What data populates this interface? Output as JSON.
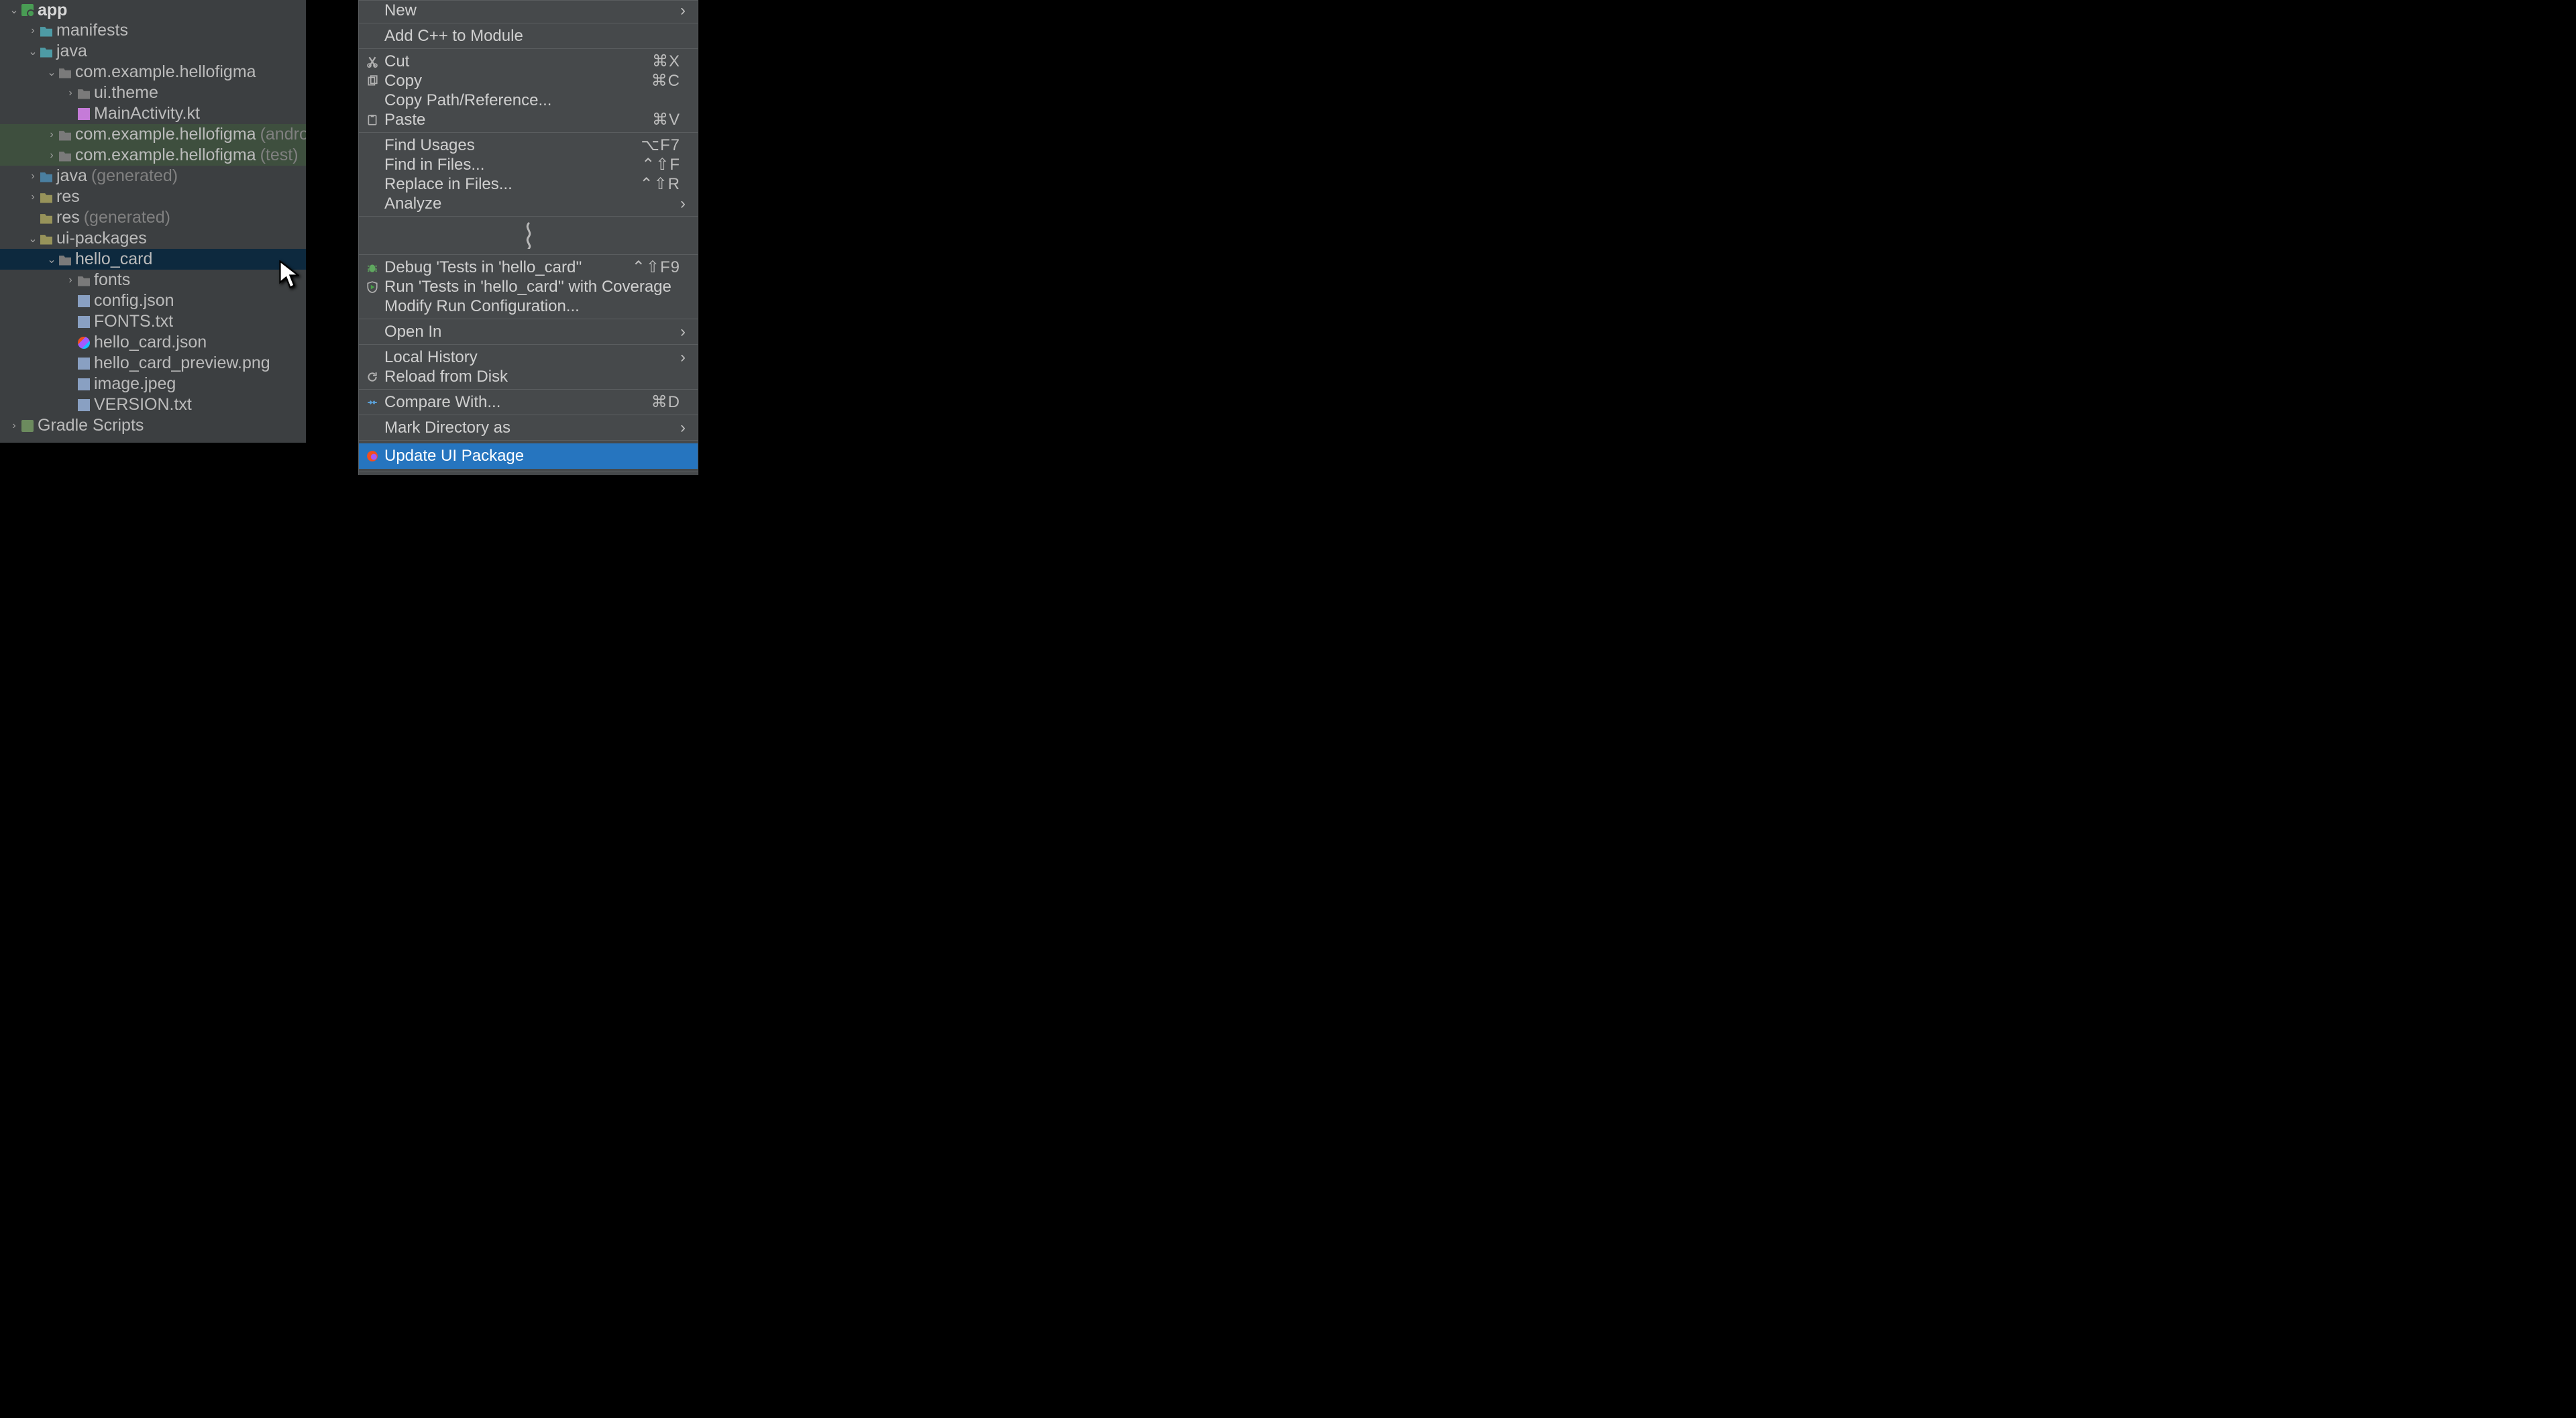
{
  "tree": {
    "rows": [
      {
        "indent": 14,
        "arrow": "v",
        "icon": "module-icon",
        "label": "app",
        "suffix": "",
        "bold": true
      },
      {
        "indent": 42,
        "arrow": ">",
        "icon": "folder-cyan",
        "label": "manifests",
        "suffix": ""
      },
      {
        "indent": 42,
        "arrow": "v",
        "icon": "folder-cyan",
        "label": "java",
        "suffix": ""
      },
      {
        "indent": 70,
        "arrow": "v",
        "icon": "folder-gray",
        "label": "com.example.hellofigma",
        "suffix": ""
      },
      {
        "indent": 98,
        "arrow": ">",
        "icon": "folder-gray",
        "label": "ui.theme",
        "suffix": ""
      },
      {
        "indent": 98,
        "arrow": "",
        "icon": "file-kt",
        "label": "MainActivity.kt",
        "suffix": ""
      },
      {
        "indent": 70,
        "arrow": ">",
        "icon": "folder-gray",
        "label": "com.example.hellofigma",
        "suffix": "(androidTest)",
        "green": true
      },
      {
        "indent": 70,
        "arrow": ">",
        "icon": "folder-gray",
        "label": "com.example.hellofigma",
        "suffix": "(test)",
        "green": true
      },
      {
        "indent": 42,
        "arrow": ">",
        "icon": "folder-gen-o",
        "label": "java",
        "suffix": "(generated)"
      },
      {
        "indent": 42,
        "arrow": ">",
        "icon": "folder-res",
        "label": "res",
        "suffix": ""
      },
      {
        "indent": 42,
        "arrow": "",
        "icon": "folder-res",
        "label": "res",
        "suffix": "(generated)"
      },
      {
        "indent": 42,
        "arrow": "v",
        "icon": "folder-res",
        "label": "ui-packages",
        "suffix": ""
      },
      {
        "indent": 70,
        "arrow": "v",
        "icon": "folder-gray",
        "label": "hello_card",
        "suffix": "",
        "selected": true
      },
      {
        "indent": 98,
        "arrow": ">",
        "icon": "folder-gray",
        "label": "fonts",
        "suffix": ""
      },
      {
        "indent": 98,
        "arrow": "",
        "icon": "file-json",
        "label": "config.json",
        "suffix": ""
      },
      {
        "indent": 98,
        "arrow": "",
        "icon": "file-txt",
        "label": "FONTS.txt",
        "suffix": ""
      },
      {
        "indent": 98,
        "arrow": "",
        "icon": "figma-icon",
        "label": "hello_card.json",
        "suffix": ""
      },
      {
        "indent": 98,
        "arrow": "",
        "icon": "file-png",
        "label": "hello_card_preview.png",
        "suffix": ""
      },
      {
        "indent": 98,
        "arrow": "",
        "icon": "file-png",
        "label": "image.jpeg",
        "suffix": ""
      },
      {
        "indent": 98,
        "arrow": "",
        "icon": "file-txt",
        "label": "VERSION.txt",
        "suffix": ""
      },
      {
        "indent": 14,
        "arrow": ">",
        "icon": "gradle-icon",
        "label": "Gradle Scripts",
        "suffix": ""
      }
    ]
  },
  "menu": {
    "items": [
      {
        "type": "item",
        "icon": "",
        "label": "New",
        "shortcut": "",
        "submenu": true
      },
      {
        "type": "sep"
      },
      {
        "type": "item",
        "icon": "",
        "label": "Add C++ to Module",
        "shortcut": "",
        "submenu": false
      },
      {
        "type": "sep"
      },
      {
        "type": "item",
        "icon": "cut",
        "label": "Cut",
        "shortcut": "⌘X",
        "submenu": false
      },
      {
        "type": "item",
        "icon": "copy",
        "label": "Copy",
        "shortcut": "⌘C",
        "submenu": false
      },
      {
        "type": "item",
        "icon": "",
        "label": "Copy Path/Reference...",
        "shortcut": "",
        "submenu": false
      },
      {
        "type": "item",
        "icon": "paste",
        "label": "Paste",
        "shortcut": "⌘V",
        "submenu": false
      },
      {
        "type": "sep"
      },
      {
        "type": "item",
        "icon": "",
        "label": "Find Usages",
        "shortcut": "⌥F7",
        "submenu": false
      },
      {
        "type": "item",
        "icon": "",
        "label": "Find in Files...",
        "shortcut": "⌃⇧F",
        "submenu": false
      },
      {
        "type": "item",
        "icon": "",
        "label": "Replace in Files...",
        "shortcut": "⌃⇧R",
        "submenu": false
      },
      {
        "type": "item",
        "icon": "",
        "label": "Analyze",
        "shortcut": "",
        "submenu": true
      },
      {
        "type": "sep"
      },
      {
        "type": "squiggle"
      },
      {
        "type": "sep"
      },
      {
        "type": "item",
        "icon": "bug",
        "label": "Debug 'Tests in 'hello_card''",
        "shortcut": "⌃⇧F9",
        "submenu": false
      },
      {
        "type": "item",
        "icon": "coverage",
        "label": "Run 'Tests in 'hello_card'' with Coverage",
        "shortcut": "",
        "submenu": false
      },
      {
        "type": "item",
        "icon": "",
        "label": "Modify Run Configuration...",
        "shortcut": "",
        "submenu": false
      },
      {
        "type": "sep"
      },
      {
        "type": "item",
        "icon": "",
        "label": "Open In",
        "shortcut": "",
        "submenu": true
      },
      {
        "type": "sep"
      },
      {
        "type": "item",
        "icon": "",
        "label": "Local History",
        "shortcut": "",
        "submenu": true
      },
      {
        "type": "item",
        "icon": "reload",
        "label": "Reload from Disk",
        "shortcut": "",
        "submenu": false
      },
      {
        "type": "sep"
      },
      {
        "type": "item",
        "icon": "compare",
        "label": "Compare With...",
        "shortcut": "⌘D",
        "submenu": false
      },
      {
        "type": "sep"
      },
      {
        "type": "item",
        "icon": "",
        "label": "Mark Directory as",
        "shortcut": "",
        "submenu": true
      },
      {
        "type": "sep"
      },
      {
        "type": "item",
        "icon": "figma",
        "label": "Update UI Package",
        "shortcut": "",
        "submenu": false,
        "highlight": true
      },
      {
        "type": "sep"
      }
    ]
  }
}
